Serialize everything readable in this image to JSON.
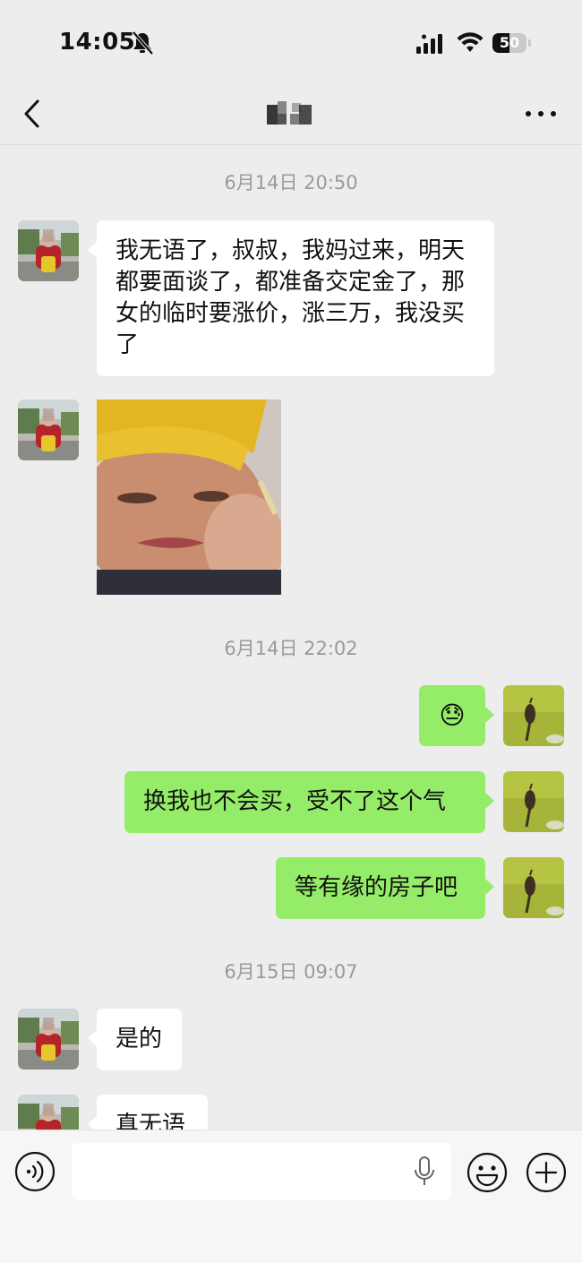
{
  "status_bar": {
    "time": "14:05",
    "battery": "50",
    "battery_level": 0.5
  },
  "nav": {
    "title_obscured": true,
    "icons": [
      "back-chevron-icon",
      "more-dots-icon"
    ]
  },
  "timestamps": [
    "6月14日 20:50",
    "6月14日 22:02",
    "6月15日 09:07"
  ],
  "messages": [
    {
      "side": "in",
      "type": "text",
      "text": "我无语了，叔叔，我妈过来，明天都要面谈了，都准备交定金了，那女的临时要涨价，涨三万，我没买了"
    },
    {
      "side": "in",
      "type": "image"
    },
    {
      "side": "out",
      "type": "emoji",
      "text": "😓"
    },
    {
      "side": "out",
      "type": "text",
      "text": "换我也不会买，受不了这个气"
    },
    {
      "side": "out",
      "type": "text",
      "text": "等有缘的房子吧"
    },
    {
      "side": "in",
      "type": "text",
      "text": "是的"
    },
    {
      "side": "in",
      "type": "text",
      "text": "真无语"
    }
  ],
  "input_bar": {
    "icons": [
      "voice-icon",
      "mic-icon",
      "emoji-icon",
      "plus-icon"
    ]
  },
  "colors": {
    "background": "#ededed",
    "outgoing_bubble": "#95ec69",
    "incoming_bubble": "#ffffff",
    "timestamp_text": "#9a9a9a"
  }
}
